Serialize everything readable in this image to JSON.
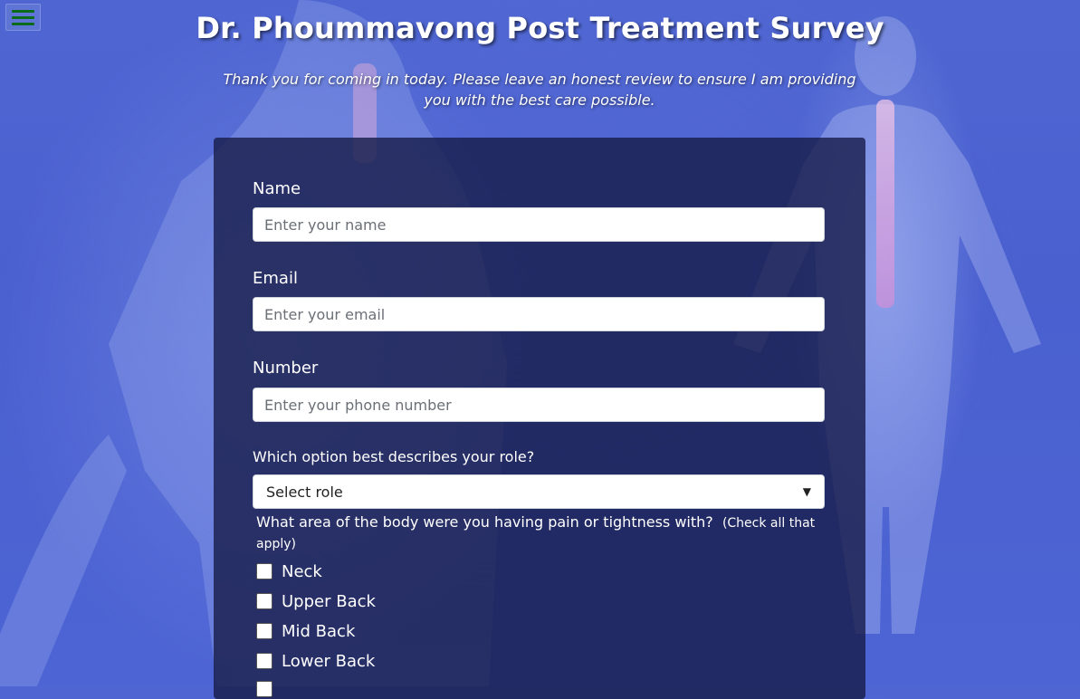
{
  "nav": {
    "menu_icon": "hamburger-menu-icon"
  },
  "header": {
    "title": "Dr. Phoummavong Post Treatment Survey",
    "subtitle": "Thank you for coming in today. Please leave an honest review to ensure I am providing you with the best care possible."
  },
  "form": {
    "name": {
      "label": "Name",
      "placeholder": "Enter your name"
    },
    "email": {
      "label": "Email",
      "placeholder": "Enter your email"
    },
    "number": {
      "label": "Number",
      "placeholder": "Enter your phone number"
    },
    "role": {
      "label": "Which option best describes your role?",
      "selected": "Select role"
    },
    "pain_area": {
      "question": "What area of the body were you having pain or tightness with?",
      "note": "(Check all that apply)",
      "options": [
        "Neck",
        "Upper Back",
        "Mid Back",
        "Lower Back"
      ]
    }
  },
  "colors": {
    "background": "#4d64d4",
    "card": "#161b48",
    "menu_bars": "#0b6b1a"
  }
}
